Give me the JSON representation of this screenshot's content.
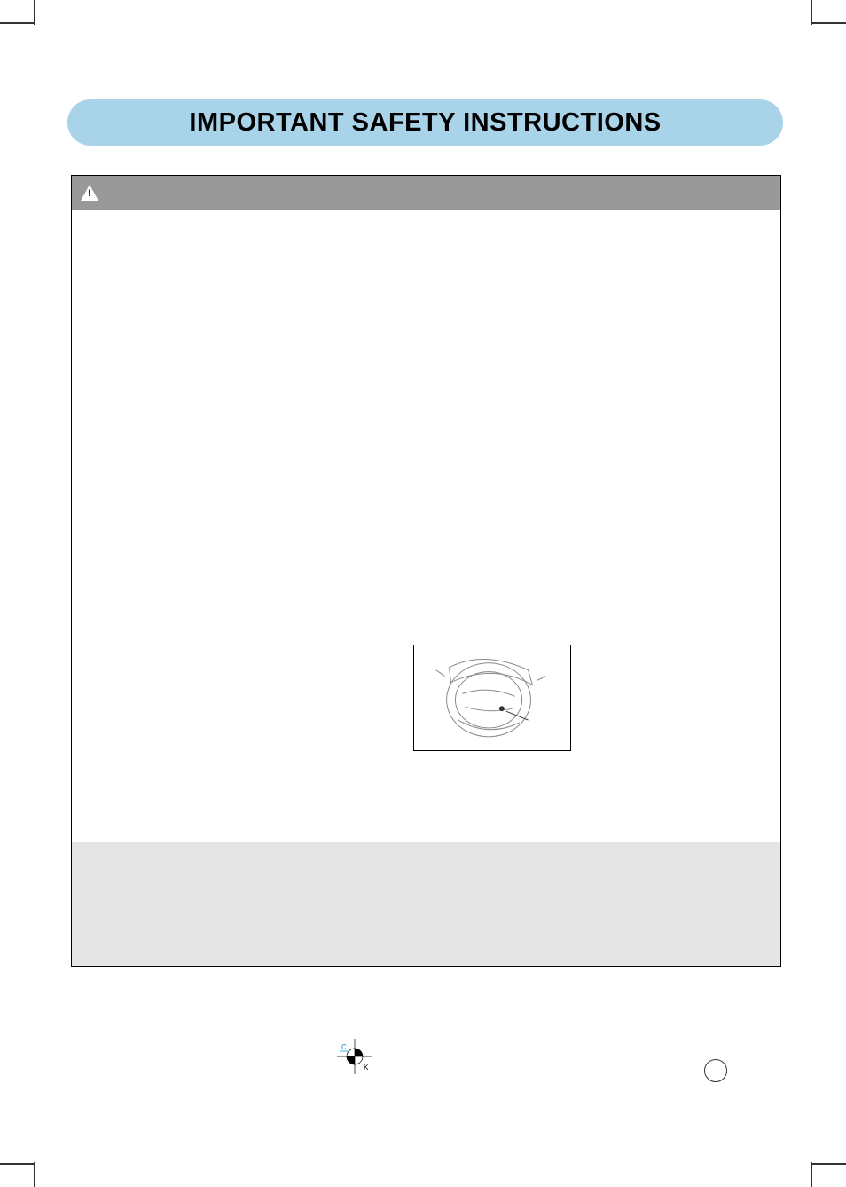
{
  "title": "IMPORTANT SAFETY INSTRUCTIONS",
  "registration": {
    "c": "C",
    "k": "K"
  }
}
